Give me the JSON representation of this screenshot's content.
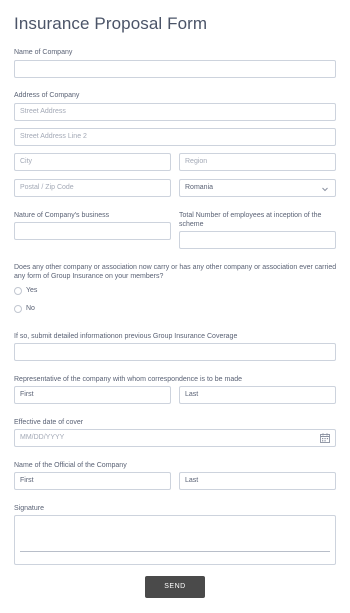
{
  "title": "Insurance Proposal Form",
  "company_name": {
    "label": "Name of Company",
    "value": ""
  },
  "address": {
    "label": "Address of Company",
    "street_placeholder": "Street Address",
    "street2_placeholder": "Street Address Line 2",
    "city_placeholder": "City",
    "region_placeholder": "Region",
    "postal_placeholder": "Postal / Zip Code",
    "country_value": "Romania"
  },
  "business": {
    "label": "Nature of Company's business",
    "value": ""
  },
  "employees": {
    "label": "Total Number of employees at inception of the scheme",
    "value": ""
  },
  "group_insurance": {
    "question": "Does any other company or association now carry or has any other company or association ever carried any form of Group Insurance on your members?",
    "options": [
      "Yes",
      "No"
    ]
  },
  "previous_coverage": {
    "label": "If so, submit detailed informationon previous Group Insurance Coverage",
    "value": ""
  },
  "representative": {
    "label": "Representative of the company with whom correspondence is to be made",
    "first_placeholder": "First",
    "last_placeholder": "Last"
  },
  "effective_date": {
    "label": "Effective date of cover",
    "placeholder": "MM/DD/YYYY"
  },
  "official": {
    "label": "Name of the Official of the Company",
    "first_placeholder": "First",
    "last_placeholder": "Last"
  },
  "signature": {
    "label": "Signature"
  },
  "submit_label": "SEND"
}
